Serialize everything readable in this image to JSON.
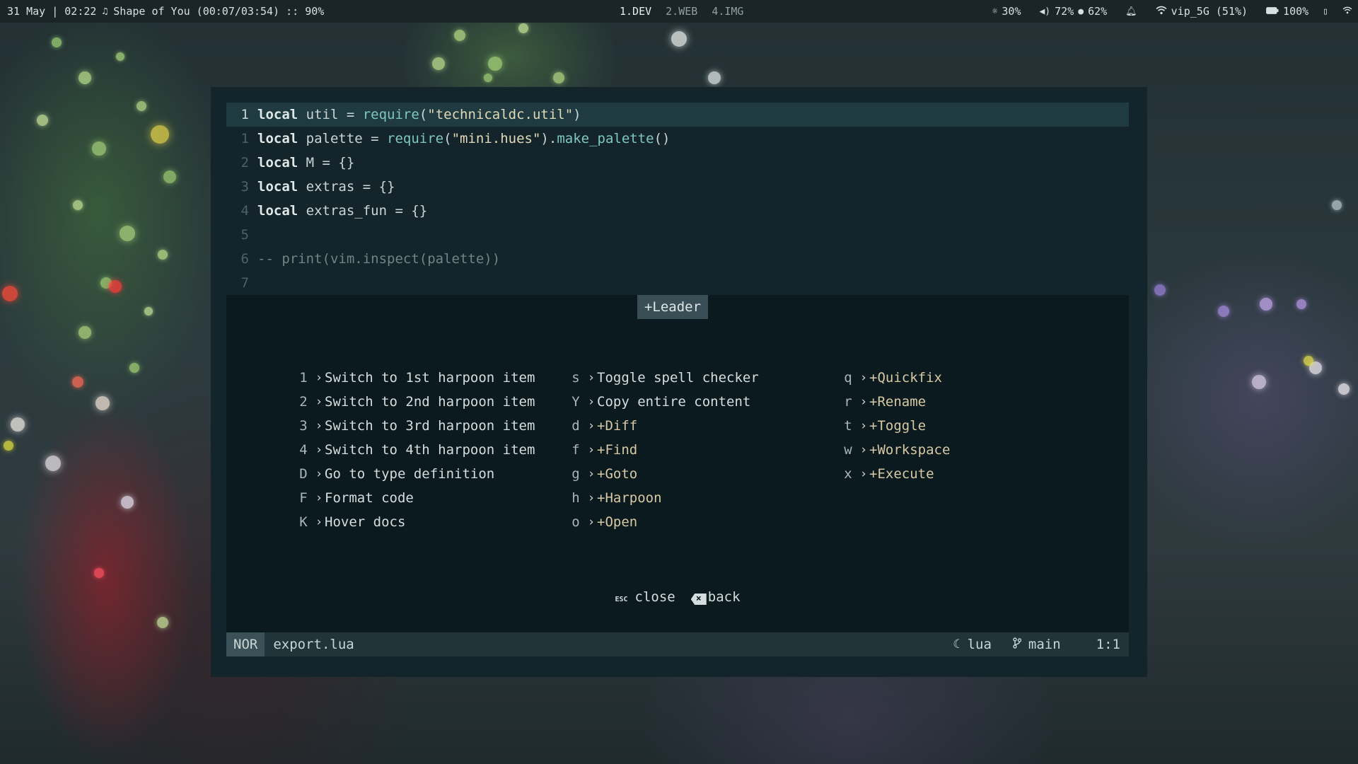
{
  "topbar": {
    "date_time": "31 May | 02:22",
    "music_icon": "music-note-icon",
    "now_playing": "Shape of You (00:07/03:54) :: 90%",
    "workspaces": [
      {
        "label": "1.DEV",
        "active": true
      },
      {
        "label": "2.WEB",
        "active": false
      },
      {
        "label": "4.IMG",
        "active": false
      }
    ],
    "brightness": "30%",
    "volume": "72%",
    "mic": "62%",
    "wifi": "vip_5G (51%)",
    "battery": "100%"
  },
  "editor": {
    "lines": [
      {
        "num": "1",
        "current": true,
        "tokens": [
          {
            "t": "kw",
            "v": "local"
          },
          {
            "t": "txt",
            "v": " util = "
          },
          {
            "t": "fn",
            "v": "require"
          },
          {
            "t": "txt",
            "v": "("
          },
          {
            "t": "str",
            "v": "\"technicaldc.util\""
          },
          {
            "t": "txt",
            "v": ")"
          }
        ]
      },
      {
        "num": "1",
        "current": false,
        "tokens": [
          {
            "t": "kw",
            "v": "local"
          },
          {
            "t": "txt",
            "v": " palette = "
          },
          {
            "t": "fn",
            "v": "require"
          },
          {
            "t": "txt",
            "v": "("
          },
          {
            "t": "str",
            "v": "\"mini.hues\""
          },
          {
            "t": "txt",
            "v": ")."
          },
          {
            "t": "fn",
            "v": "make_palette"
          },
          {
            "t": "txt",
            "v": "()"
          }
        ]
      },
      {
        "num": "2",
        "current": false,
        "tokens": [
          {
            "t": "kw",
            "v": "local"
          },
          {
            "t": "txt",
            "v": " M = {}"
          }
        ]
      },
      {
        "num": "3",
        "current": false,
        "tokens": [
          {
            "t": "kw",
            "v": "local"
          },
          {
            "t": "txt",
            "v": " extras = {}"
          }
        ]
      },
      {
        "num": "4",
        "current": false,
        "tokens": [
          {
            "t": "kw",
            "v": "local"
          },
          {
            "t": "txt",
            "v": " extras_fun = {}"
          }
        ]
      },
      {
        "num": "5",
        "current": false,
        "tokens": []
      },
      {
        "num": "6",
        "current": false,
        "tokens": [
          {
            "t": "cmt",
            "v": "-- print(vim.inspect(palette))"
          }
        ]
      },
      {
        "num": "7",
        "current": false,
        "tokens": []
      }
    ]
  },
  "whichkey": {
    "title": "+Leader",
    "columns": [
      [
        {
          "key": "1",
          "label": "Switch to 1st harpoon item",
          "group": false
        },
        {
          "key": "2",
          "label": "Switch to 2nd harpoon item",
          "group": false
        },
        {
          "key": "3",
          "label": "Switch to 3rd harpoon item",
          "group": false
        },
        {
          "key": "4",
          "label": "Switch to 4th harpoon item",
          "group": false
        },
        {
          "key": "D",
          "label": "Go to type definition",
          "group": false
        },
        {
          "key": "F",
          "label": "Format code",
          "group": false
        },
        {
          "key": "K",
          "label": "Hover docs",
          "group": false
        }
      ],
      [
        {
          "key": "s",
          "label": "Toggle spell checker",
          "group": false
        },
        {
          "key": "Y",
          "label": "Copy entire content",
          "group": false
        },
        {
          "key": "d",
          "label": "+Diff",
          "group": true
        },
        {
          "key": "f",
          "label": "+Find",
          "group": true
        },
        {
          "key": "g",
          "label": "+Goto",
          "group": true
        },
        {
          "key": "h",
          "label": "+Harpoon",
          "group": true
        },
        {
          "key": "o",
          "label": "+Open",
          "group": true
        }
      ],
      [
        {
          "key": "q",
          "label": "+Quickfix",
          "group": true
        },
        {
          "key": "r",
          "label": "+Rename",
          "group": true
        },
        {
          "key": "t",
          "label": "+Toggle",
          "group": true
        },
        {
          "key": "w",
          "label": "+Workspace",
          "group": true
        },
        {
          "key": "x",
          "label": "+Execute",
          "group": true
        }
      ]
    ],
    "footer": {
      "esc_label": "ESC",
      "close": "close",
      "back_icon_label": "×",
      "back": "back"
    }
  },
  "statusline": {
    "mode": "NOR",
    "filename": "export.lua",
    "filetype": "lua",
    "branch": "main",
    "position": "1:1"
  }
}
